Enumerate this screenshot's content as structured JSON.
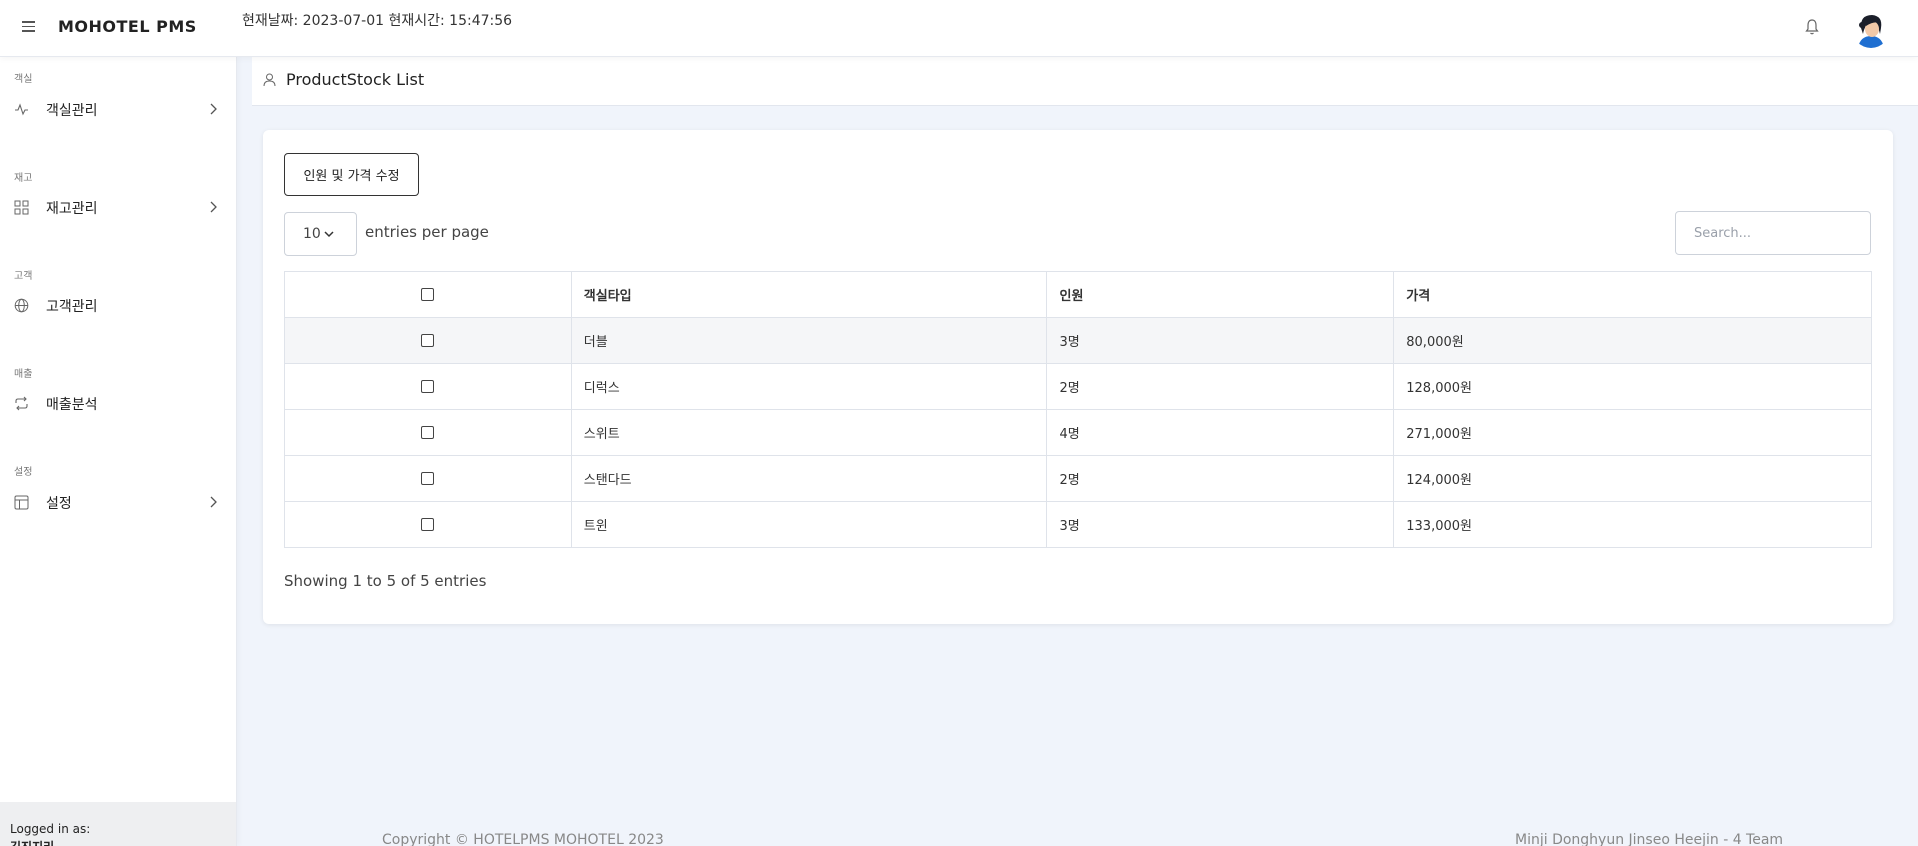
{
  "header": {
    "brand": "MOHOTEL PMS",
    "clock": "현재날짜: 2023-07-01 현재시간: 15:47:56"
  },
  "sidebar": {
    "sections": [
      {
        "heading": "객실",
        "item": "객실관리",
        "icon": "activity-icon",
        "has_submenu": true
      },
      {
        "heading": "재고",
        "item": "재고관리",
        "icon": "grid-icon",
        "has_submenu": true
      },
      {
        "heading": "고객",
        "item": "고객관리",
        "icon": "globe-icon",
        "has_submenu": false
      },
      {
        "heading": "매출",
        "item": "매출분석",
        "icon": "repeat-icon",
        "has_submenu": false
      },
      {
        "heading": "설정",
        "item": "설정",
        "icon": "layout-icon",
        "has_submenu": true
      }
    ],
    "logged_in_label": "Logged in as:",
    "user_name": "김진지리"
  },
  "page": {
    "title": "ProductStock List",
    "title_icon": "user-icon"
  },
  "toolbar": {
    "edit_button": "인원 및 가격 수정",
    "per_page_value": "10",
    "per_page_label": "entries per page",
    "search_placeholder": "Search..."
  },
  "table": {
    "columns": [
      "",
      "객실타입",
      "인원",
      "가격"
    ],
    "rows": [
      {
        "type": "더블",
        "people": "3명",
        "price": "80,000원"
      },
      {
        "type": "디럭스",
        "people": "2명",
        "price": "128,000원"
      },
      {
        "type": "스위트",
        "people": "4명",
        "price": "271,000원"
      },
      {
        "type": "스탠다드",
        "people": "2명",
        "price": "124,000원"
      },
      {
        "type": "트윈",
        "people": "3명",
        "price": "133,000원"
      }
    ],
    "showing": "Showing 1 to 5 of 5 entries"
  },
  "footer": {
    "copyright": "Copyright © HOTELPMS MOHOTEL 2023",
    "team": "Minji Donghyun Jinseo Heejin - 4 Team"
  },
  "colors": {
    "background": "#f0f4fb",
    "card": "#ffffff",
    "stripe": "#f5f6f8",
    "border": "#dfe3ea"
  }
}
